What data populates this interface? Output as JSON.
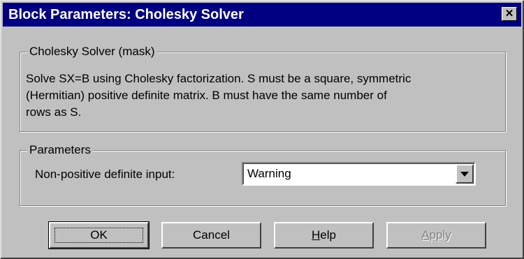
{
  "window": {
    "title": "Block Parameters: Cholesky Solver",
    "close_glyph": "✕"
  },
  "mask_group": {
    "legend": "Cholesky Solver (mask)",
    "description_lines": [
      "Solve SX=B using Cholesky factorization.  S must be a square, symmetric",
      "(Hermitian) positive definite matrix.  B must have the same number of",
      "rows as S."
    ]
  },
  "parameters_group": {
    "legend": "Parameters",
    "field_label": "Non-positive definite input:",
    "field_value": "Warning"
  },
  "buttons": {
    "ok": "OK",
    "cancel": "Cancel",
    "help_first": "H",
    "help_rest": "elp",
    "apply_first": "A",
    "apply_rest": "pply"
  },
  "colors": {
    "titlebar": "#000080",
    "face": "#c0c0c0",
    "disabled_text": "#808080"
  },
  "icons": {
    "close": "close-icon",
    "dropdown": "chevron-down-icon"
  }
}
